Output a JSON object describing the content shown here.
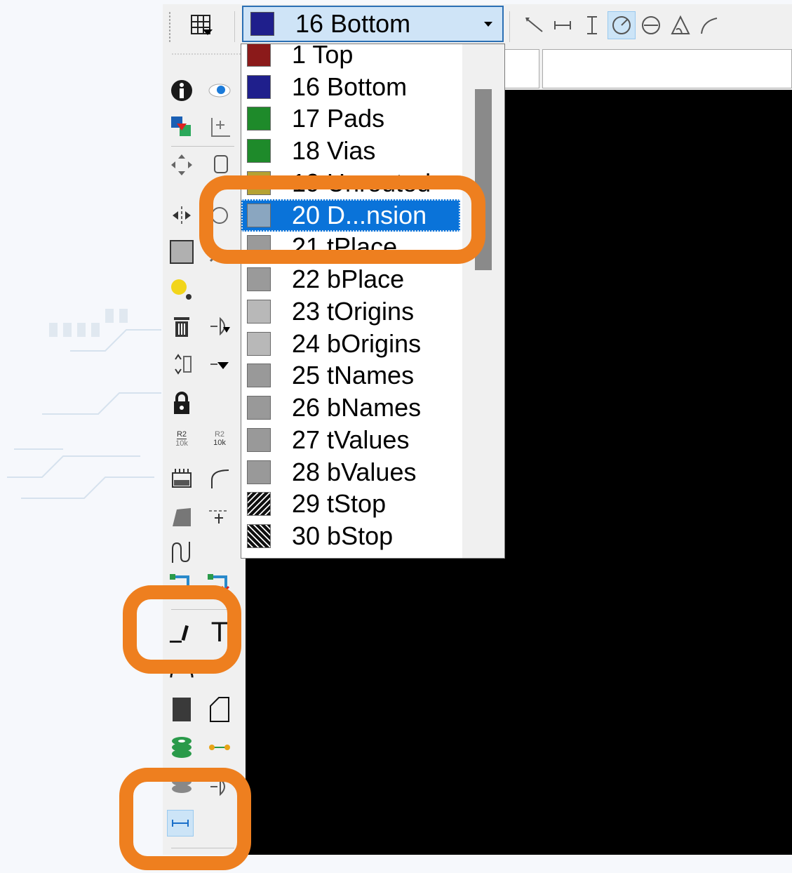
{
  "toolbar": {
    "layer_select": {
      "selected_label": "16 Bottom",
      "selected_color": "#1f1f8c"
    },
    "tools": [
      "grid-icon",
      "wire-icon",
      "dimension-horizontal-icon",
      "dimension-vertical-icon",
      "dimension-radius-icon",
      "dimension-diameter-icon",
      "dimension-angle-icon",
      "dimension-leader-icon"
    ],
    "active_tool": "dimension-radius-icon"
  },
  "layer_list": {
    "items": [
      {
        "label": "1 Top",
        "color": "#8b1a1a"
      },
      {
        "label": "16 Bottom",
        "color": "#1f1f8c"
      },
      {
        "label": "17 Pads",
        "color": "#1e8a2a"
      },
      {
        "label": "18 Vias",
        "color": "#1e8a2a"
      },
      {
        "label": "19 Unrouted",
        "color": "#b5a233"
      },
      {
        "label": "20 D...nsion",
        "color": "#8aa6c0"
      },
      {
        "label": "21 tPlace",
        "color": "#9a9a9a"
      },
      {
        "label": "22 bPlace",
        "color": "#9a9a9a"
      },
      {
        "label": "23 tOrigins",
        "color": "#b8b8b8"
      },
      {
        "label": "24 bOrigins",
        "color": "#b8b8b8"
      },
      {
        "label": "25 tNames",
        "color": "#999999"
      },
      {
        "label": "26 bNames",
        "color": "#999999"
      },
      {
        "label": "27 tValues",
        "color": "#999999"
      },
      {
        "label": "28 bValues",
        "color": "#999999"
      },
      {
        "label": "29 tStop",
        "color": "#111111"
      },
      {
        "label": "30 bStop",
        "color": "#111111"
      }
    ],
    "selected_index": 5
  },
  "left_toolbar": {
    "labels": {
      "resistor_top": "R2",
      "resistor_bottom": "10k"
    }
  },
  "colors": {
    "highlight": "#ee7f1f",
    "accent": "#0a73d9",
    "canvas": "#000000"
  }
}
